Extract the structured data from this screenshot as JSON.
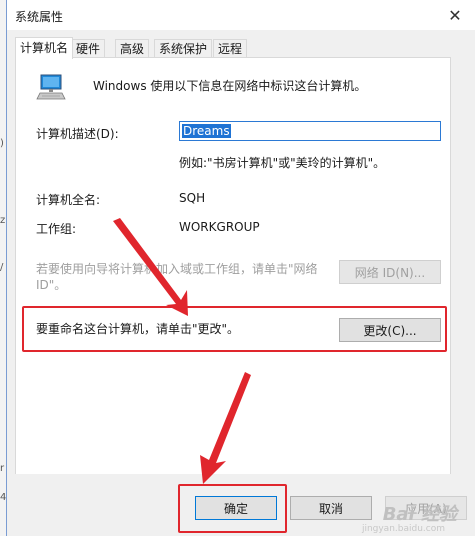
{
  "window": {
    "title": "系统属性",
    "close_glyph": "✕"
  },
  "tabs": [
    {
      "label": "计算机名",
      "active": true
    },
    {
      "label": "硬件",
      "active": false
    },
    {
      "label": "高级",
      "active": false
    },
    {
      "label": "系统保护",
      "active": false
    },
    {
      "label": "远程",
      "active": false
    }
  ],
  "panel": {
    "intro_text": "Windows 使用以下信息在网络中标识这台计算机。",
    "description_label": "计算机描述(D):",
    "description_value": "Dreams",
    "example_text": "例如:\"书房计算机\"或\"美玲的计算机\"。",
    "full_name_label": "计算机全名:",
    "full_name_value": "SQH",
    "workgroup_label": "工作组:",
    "workgroup_value": "WORKGROUP",
    "network_hint_line1": "若要使用向导将计算机加入域或工作组，请单击\"网络",
    "network_hint_line2": "ID\"。",
    "network_id_button": "网络 ID(N)...",
    "rename_hint": "要重命名这台计算机，请单击\"更改\"。",
    "change_button": "更改(C)..."
  },
  "footer": {
    "ok_button": "确定",
    "cancel_button": "取消",
    "apply_button": "应用(A)"
  },
  "watermark": {
    "text": "Bai 经验",
    "sub": "jingyan.baidu.com"
  },
  "colors": {
    "annotation_red": "#e0262d",
    "selection_blue": "#1f73d4"
  }
}
